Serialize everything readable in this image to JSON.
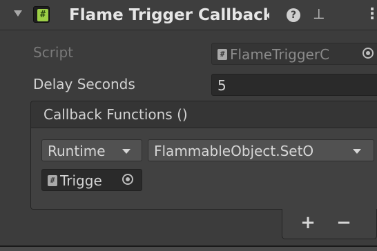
{
  "component": {
    "title": "Flame Trigger Callback",
    "icons": {
      "foldout": "triangle-down-icon",
      "script": "hash-script-icon",
      "help": "question-circle-icon",
      "presets": "sliders-icon",
      "menu": "vertical-ellipsis-icon"
    }
  },
  "fields": {
    "script_label": "Script",
    "script_value": "FlameTriggerC",
    "delay_label": "Delay Seconds",
    "delay_value": "5"
  },
  "event": {
    "header": "Callback Functions ()",
    "listener": {
      "call_state": "Runtime",
      "function": "FlammableObject.SetO",
      "target": "Trigge"
    },
    "add_label": "+",
    "remove_label": "−"
  },
  "colors": {
    "background": "#3c3c3c",
    "script_icon": "#9ccf46",
    "text": "#d2d2d2"
  }
}
